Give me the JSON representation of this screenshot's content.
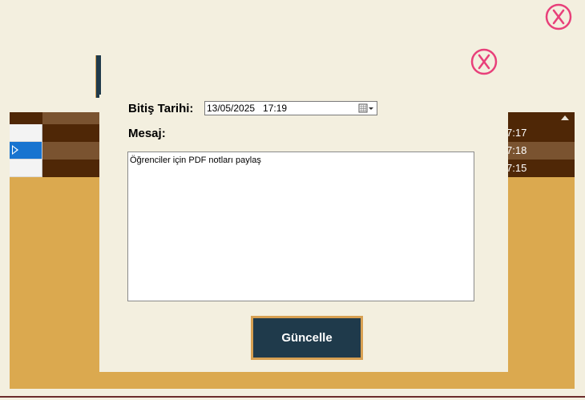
{
  "window": {
    "close_icon": "close-x-icon",
    "accent_close": "#e8407a"
  },
  "grid": {
    "rows": [
      {
        "time": "7:17",
        "selected": false
      },
      {
        "time": "7:18",
        "selected": true
      },
      {
        "time": "7:15",
        "selected": false
      }
    ],
    "colors": {
      "dark_row": "#4f2706",
      "light_row": "#7a5330",
      "background": "#dba94f"
    }
  },
  "dialog": {
    "end_date_label": "Bitiş Tarihi:",
    "end_date_value": "13/05/2025   17:19",
    "message_label": "Mesaj:",
    "message_value": "Öğrenciler için PDF notları paylaş",
    "update_button": "Güncelle",
    "button_color": "#1f3a4b",
    "button_border": "#d7a052"
  }
}
